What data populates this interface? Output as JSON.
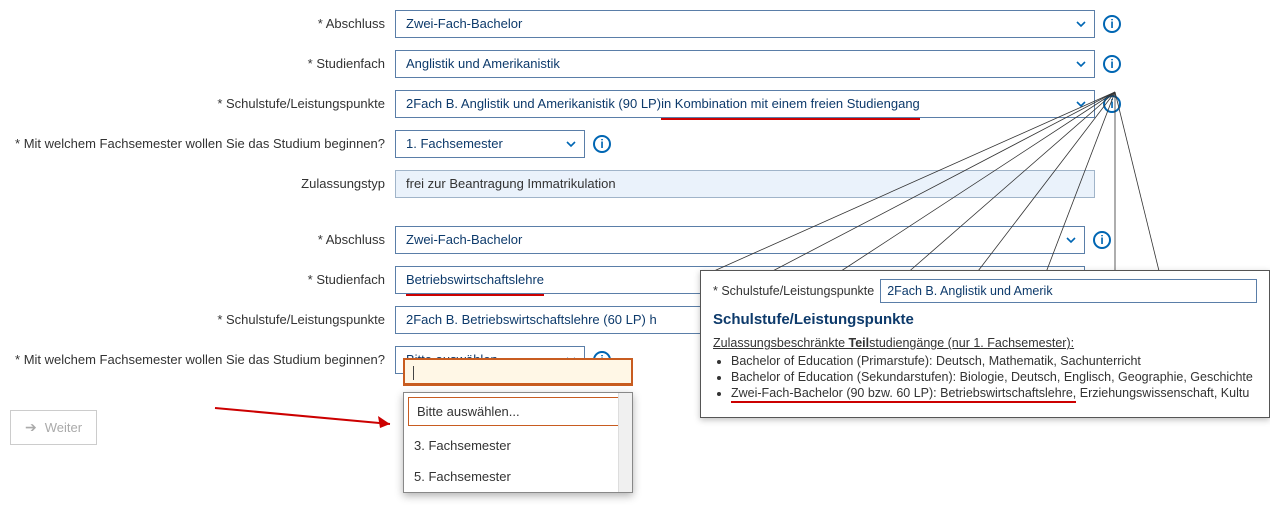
{
  "form1": {
    "abschluss": {
      "label": "* Abschluss",
      "value": "Zwei-Fach-Bachelor"
    },
    "studienfach": {
      "label": "* Studienfach",
      "value": "Anglistik und Amerikanistik"
    },
    "schulstufe": {
      "label": "* Schulstufe/Leistungspunkte",
      "value_pre": "2Fach B. Anglistik und Amerikanistik (90 LP)",
      "value_mark": " in Kombination mit einem freien Studiengang"
    },
    "fachsemester": {
      "label": "* Mit welchem Fachsemester wollen Sie das Studium beginnen?",
      "value": "1. Fachsemester"
    },
    "zulassungstyp": {
      "label": "Zulassungstyp",
      "value": "frei zur Beantragung Immatrikulation"
    }
  },
  "form2": {
    "abschluss": {
      "label": "* Abschluss",
      "value": "Zwei-Fach-Bachelor"
    },
    "studienfach": {
      "label": "* Studienfach",
      "value": "Betriebswirtschaftslehre"
    },
    "schulstufe": {
      "label": "* Schulstufe/Leistungspunkte",
      "value": "2Fach B. Betriebswirtschaftslehre (60 LP) h"
    },
    "fachsemester": {
      "label": "* Mit welchem Fachsemester wollen Sie das Studium beginnen?",
      "value": "Bitte auswählen..."
    }
  },
  "dropdown": {
    "placeholder": "Bitte auswählen...",
    "opt1": "3. Fachsemester",
    "opt2": "5. Fachsemester"
  },
  "popup": {
    "row_label": "* Schulstufe/Leistungspunkte",
    "row_value": "2Fach B. Anglistik und Amerik",
    "title": "Schulstufe/Leistungspunkte",
    "subhead_pre": "Zulassungsbeschränkte ",
    "subhead_bold": "Teil",
    "subhead_post": "studiengänge (nur 1. Fachsemester):",
    "b1": "Bachelor of Education (Primarstufe): Deutsch, Mathematik, Sachunterricht",
    "b2": "Bachelor of Education (Sekundarstufen): Biologie, Deutsch, Englisch, Geographie, Geschichte",
    "b3_pre": "Zwei-Fach-Bachelor (90 bzw. 60 LP): Betriebswirtschaftslehre,",
    "b3_post": " Erziehungswissenschaft, Kultu"
  },
  "buttons": {
    "next": "Weiter"
  },
  "info_glyph": "i"
}
